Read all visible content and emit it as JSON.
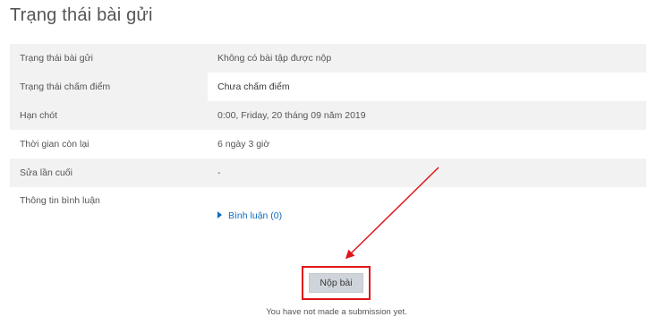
{
  "page": {
    "title": "Trạng thái bài gửi"
  },
  "status_table": {
    "rows": [
      {
        "label": "Trạng thái bài gửi",
        "value": "Không có bài tập được nộp"
      },
      {
        "label": "Trạng thái chấm điểm",
        "value": "Chưa chấm điểm"
      },
      {
        "label": "Hạn chót",
        "value": "0:00, Friday, 20 tháng 09 năm 2019"
      },
      {
        "label": "Thời gian còn lại",
        "value": "6 ngày 3 giờ"
      },
      {
        "label": "Sửa lần cuối",
        "value": "-"
      },
      {
        "label": "Thông tin bình luận",
        "link": "Bình luận (0)"
      }
    ]
  },
  "actions": {
    "submit_label": "Nộp bài",
    "note": "You have not made a submission yet."
  },
  "annotation": {
    "highlight_color": "#e0161b",
    "arrow_color": "#e0161b"
  }
}
